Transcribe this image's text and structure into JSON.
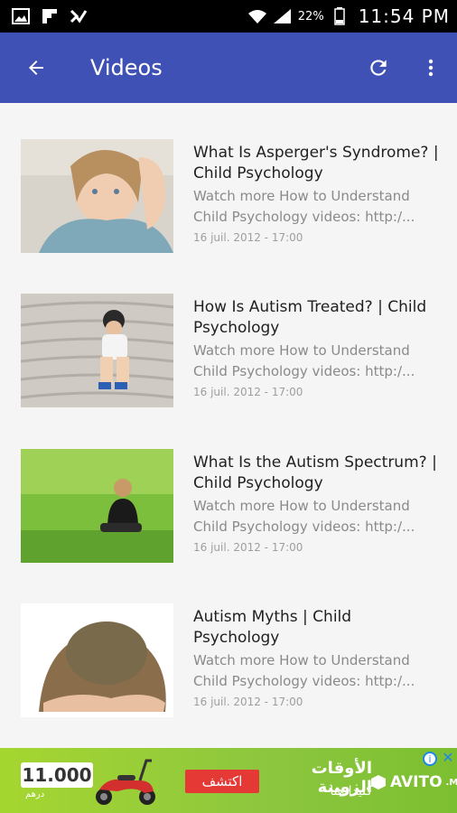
{
  "status_bar": {
    "battery_percent": "22%",
    "time": "11:54 PM"
  },
  "app_bar": {
    "title": "Videos",
    "icons": [
      "back-arrow-icon",
      "refresh-icon",
      "more-vert-icon"
    ]
  },
  "videos": [
    {
      "title": "What Is Asperger's Syndrome? | Child Psychology",
      "description": "Watch more How to Understand Child Psychology videos: http:/...",
      "date": "16 juil. 2012 - 17:00"
    },
    {
      "title": "How Is Autism Treated? | Child Psychology",
      "description": "Watch more How to Understand Child Psychology videos: http:/...",
      "date": "16 juil. 2012 - 17:00"
    },
    {
      "title": "What Is the Autism Spectrum? | Child Psychology",
      "description": "Watch more How to Understand Child Psychology videos: http:/...",
      "date": "16 juil. 2012 - 17:00"
    },
    {
      "title": "Autism Myths | Child Psychology",
      "description": "Watch more How to Understand Child Psychology videos: http:/...",
      "date": "16 juil. 2012 - 17:00"
    }
  ],
  "ad": {
    "price": "11.000",
    "currency": "درهم",
    "cta": "اكتشف",
    "headline": "الأوقات الزوينة",
    "subline": "كثيدا هنا",
    "brand": "AVITO",
    "brand_suffix": ".MA"
  },
  "colors": {
    "app_bar": "#3f51b5",
    "status_bar": "#000000",
    "ad_background": "#8cc63f",
    "ad_cta": "#e53935"
  }
}
